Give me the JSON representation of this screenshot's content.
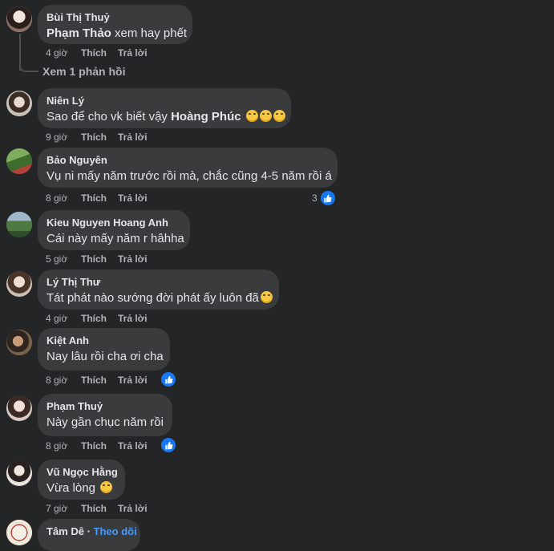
{
  "comments": [
    {
      "author": "Bùi Thị Thuỷ",
      "mention": "Phạm Thảo",
      "text": " xem hay phết",
      "time": "4 giờ",
      "like": "Thích",
      "reply": "Trả lời"
    },
    {
      "author": "Niên Lý",
      "text": "Sao để cho vk biết vậy ",
      "mention": "Hoàng Phúc",
      "time": "9 giờ",
      "like": "Thích",
      "reply": "Trả lời"
    },
    {
      "author": "Bảo Nguyên",
      "text": "Vụ ni mấy năm trước rồi mà, chắc cũng 4-5 năm rồi á",
      "time": "8 giờ",
      "like": "Thích",
      "reply": "Trả lời",
      "reaction_count": "3"
    },
    {
      "author": "Kieu Nguyen Hoang Anh",
      "text": "Cái này mấy năm r hâhha",
      "time": "5 giờ",
      "like": "Thích",
      "reply": "Trả lời"
    },
    {
      "author": "Lý Thị Thư",
      "text": "Tát phát nào sướng đời phát ấy luôn đã",
      "time": "4 giờ",
      "like": "Thích",
      "reply": "Trả lời"
    },
    {
      "author": "Kiệt Anh",
      "text": "Nay lâu rồi cha ơi cha",
      "time": "8 giờ",
      "like": "Thích",
      "reply": "Trả lời"
    },
    {
      "author": "Phạm Thuỷ",
      "text": "Này gần chục năm rồi",
      "time": "8 giờ",
      "like": "Thích",
      "reply": "Trả lời"
    },
    {
      "author": "Vũ Ngọc Hằng",
      "text": "Vừa lòng ",
      "time": "7 giờ",
      "like": "Thích",
      "reply": "Trả lời"
    },
    {
      "author": "Tâm Dê",
      "follow": "Theo dõi"
    }
  ],
  "view_replies": "Xem 1 phản hồi",
  "icons": {
    "like": "like-icon",
    "emoji": "emoji-icon"
  },
  "colors": {
    "background": "#242526",
    "bubble": "#3a3b3c",
    "like_blue": "#1877f2",
    "follow": "#4599ff"
  }
}
